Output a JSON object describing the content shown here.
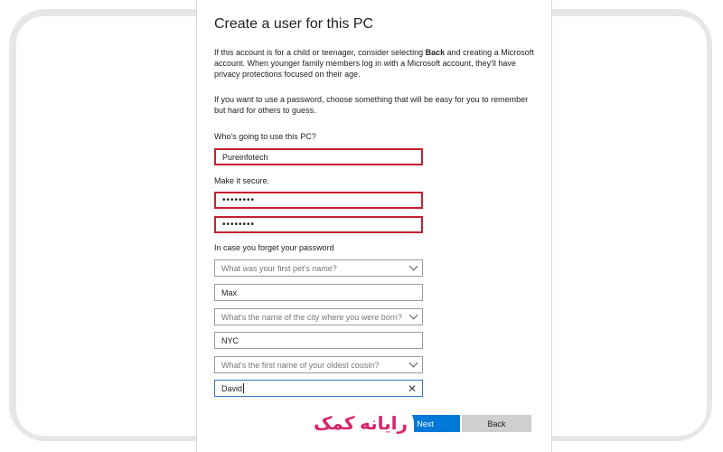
{
  "dialog": {
    "title": "Create a user for this PC",
    "intro_part1": "If this account is for a child or teenager, consider selecting ",
    "intro_bold": "Back",
    "intro_part2": " and creating a Microsoft account. When younger family members log in with a Microsoft account, they'll have privacy protections focused on their age.",
    "password_hint": "If you want to use a password, choose something that will be easy for you to remember but hard for others to guess."
  },
  "form": {
    "username_label": "Who's going to use this PC?",
    "username_value": "Pureinfotech",
    "secure_label": "Make it secure.",
    "password_value": "••••••••",
    "password_confirm_value": "••••••••",
    "recovery_label": "In case you forget your password",
    "q1_placeholder": "What was your first pet's name?",
    "a1_value": "Max",
    "q2_placeholder": "What's the name of the city where you were born?",
    "a2_value": "NYC",
    "q3_placeholder": "What's the first name of your oldest cousin?",
    "a3_value": "David"
  },
  "buttons": {
    "next_label": "Next",
    "back_label": "Back"
  },
  "watermark": {
    "text": "رایانه کمک"
  },
  "colors": {
    "highlight_border": "#c8202f",
    "primary_button": "#0078d7",
    "watermark": "#d6246e"
  }
}
